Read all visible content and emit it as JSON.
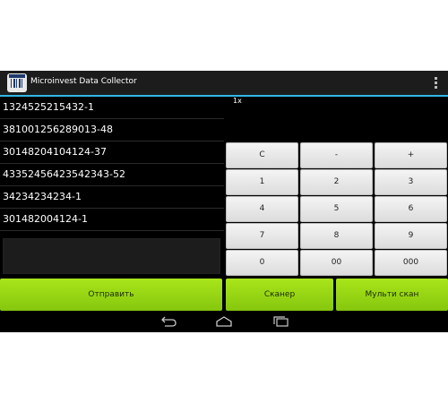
{
  "app": {
    "title": "Microinvest Data Collector"
  },
  "list": {
    "items": [
      "1324525215432-1",
      "381001256289013-48",
      "30148204104124-37",
      "43352456423542343-52",
      "34234234234-1",
      "301482004124-1"
    ]
  },
  "counter": "1x",
  "keypad": {
    "rows": [
      [
        "C",
        "-",
        "+"
      ],
      [
        "1",
        "2",
        "3"
      ],
      [
        "4",
        "5",
        "6"
      ],
      [
        "7",
        "8",
        "9"
      ],
      [
        "0",
        "00",
        "000"
      ]
    ]
  },
  "buttons": {
    "send": "Отправить",
    "scanner": "Сканер",
    "multi_scan": "Мульти скан"
  },
  "colors": {
    "accent": "#33b5e5",
    "green": "#99d613"
  }
}
